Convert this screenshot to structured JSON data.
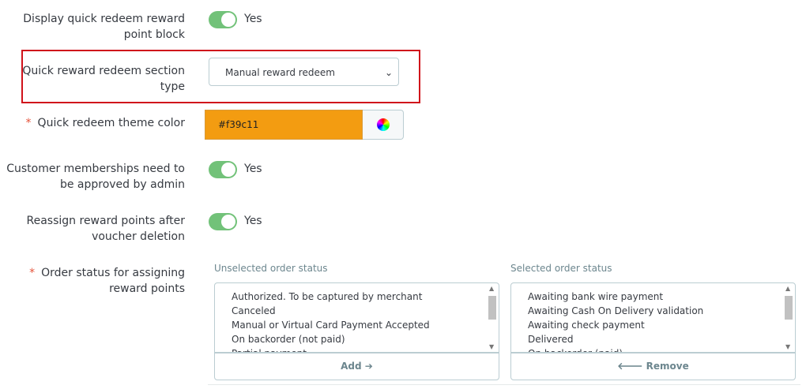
{
  "fields": {
    "display_block": {
      "label": "Display quick redeem reward point block",
      "value": "Yes"
    },
    "section_type": {
      "label": "Quick reward redeem section type",
      "value": "Manual reward redeem"
    },
    "theme_color": {
      "label": "Quick redeem theme color",
      "value": "#f39c11",
      "required": "*"
    },
    "memberships": {
      "label": "Customer memberships need to be approved by admin",
      "value": "Yes"
    },
    "reassign": {
      "label": "Reassign reward points after voucher deletion",
      "value": "Yes"
    },
    "order_status": {
      "label": "Order status for assigning reward points",
      "required": "*"
    }
  },
  "unselected": {
    "title": "Unselected order status",
    "items": [
      "Authorized. To be captured by merchant",
      "Canceled",
      "Manual or Virtual Card Payment Accepted",
      "On backorder (not paid)",
      "Partial payment"
    ],
    "button": "Add ➔"
  },
  "selected": {
    "title": "Selected order status",
    "items": [
      "Awaiting bank wire payment",
      "Awaiting Cash On Delivery validation",
      "Awaiting check payment",
      "Delivered",
      "On backorder (paid)"
    ],
    "button": "🡐 Remove"
  },
  "colors": {
    "accent": "#72c279",
    "highlight": "#d0121b",
    "theme": "#f39c11"
  }
}
